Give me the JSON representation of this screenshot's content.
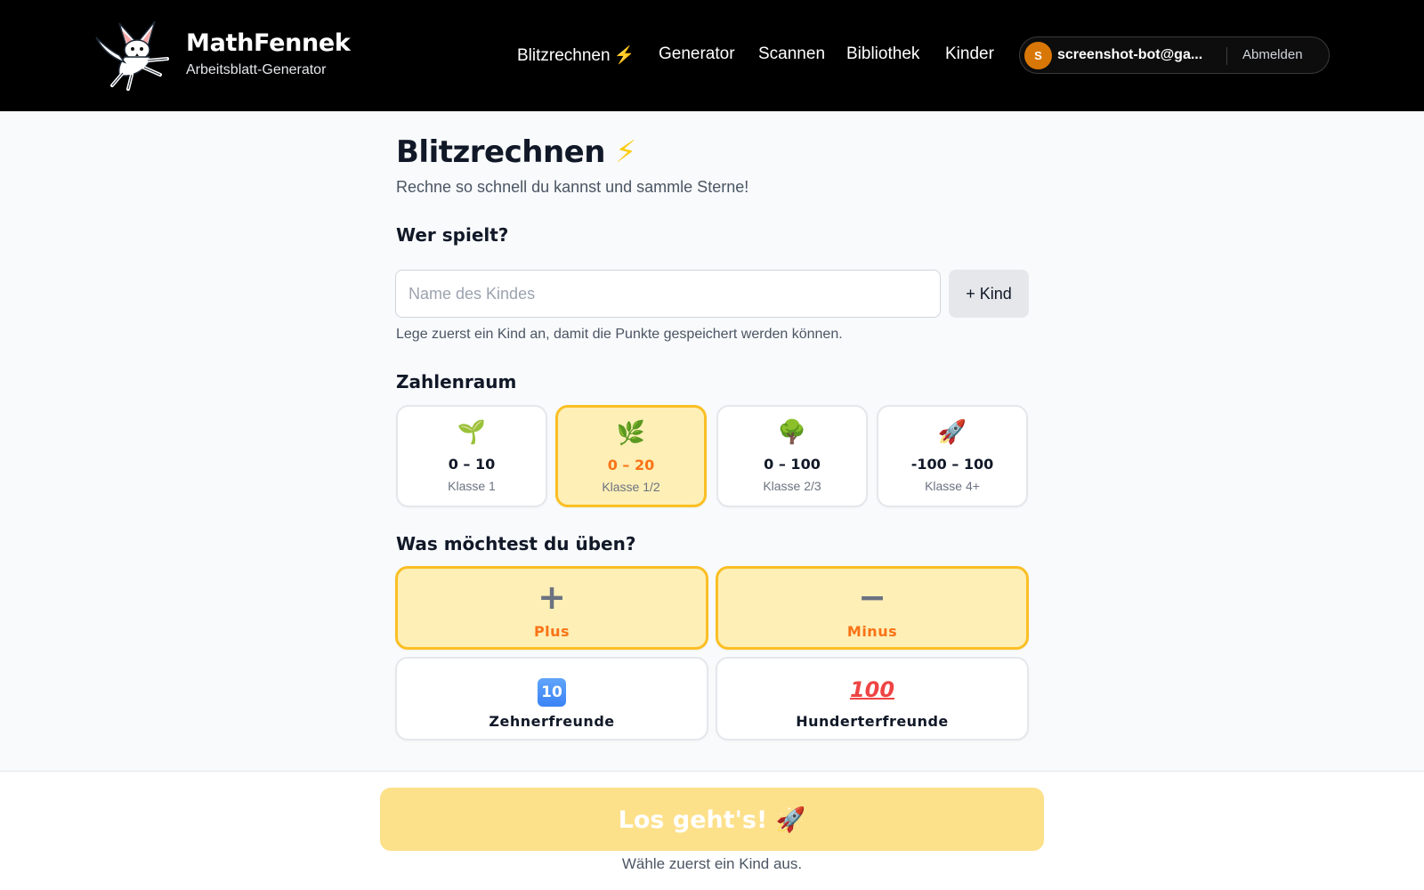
{
  "header": {
    "brand_title": "MathFennek",
    "brand_subtitle": "Arbeitsblatt-Generator",
    "logo_icon": "fennec-fox-logo",
    "nav": [
      {
        "label": "Blitzrechnen",
        "icon": "⚡"
      },
      {
        "label": "Generator"
      },
      {
        "label": "Scannen"
      },
      {
        "label": "Bibliothek"
      },
      {
        "label": "Kinder"
      }
    ],
    "user": {
      "avatar_initial": "S",
      "email": "screenshot-bot@ga...",
      "logout_label": "Abmelden"
    }
  },
  "main": {
    "title": "Blitzrechnen",
    "title_icon": "⚡",
    "subtitle": "Rechne so schnell du kannst und sammle Sterne!",
    "who_heading": "Wer spielt?",
    "name_placeholder": "Name des Kindes",
    "name_value": "",
    "add_child_label": "+ Kind",
    "hint": "Lege zuerst ein Kind an, damit die Punkte gespeichert werden können.",
    "range_heading": "Zahlenraum",
    "ranges": [
      {
        "emoji": "🌱",
        "label": "0 – 10",
        "sub": "Klasse 1",
        "selected": false
      },
      {
        "emoji": "🌿",
        "label": "0 – 20",
        "sub": "Klasse 1/2",
        "selected": true
      },
      {
        "emoji": "🌳",
        "label": "0 – 100",
        "sub": "Klasse 2/3",
        "selected": false
      },
      {
        "emoji": "🚀",
        "label": "-100 – 100",
        "sub": "Klasse 4+",
        "selected": false
      }
    ],
    "ops_heading": "Was möchtest du üben?",
    "ops": [
      {
        "icon": "➕",
        "label": "Plus",
        "selected": true
      },
      {
        "icon": "➖",
        "label": "Minus",
        "selected": true
      },
      {
        "icon": "🔟",
        "label": "Zehnerfreunde",
        "selected": false
      },
      {
        "icon": "💯",
        "label": "Hunderterfreunde",
        "selected": false
      }
    ]
  },
  "footer": {
    "start_label": "Los geht's!",
    "start_icon": "🚀",
    "hint": "Wähle zuerst ein Kind aus."
  },
  "colors": {
    "accent": "#fbbf24",
    "selected_bg": "#fdefb6",
    "selected_text": "#f97316",
    "start_button_disabled": "#fde08a",
    "header_bg": "#000000"
  }
}
